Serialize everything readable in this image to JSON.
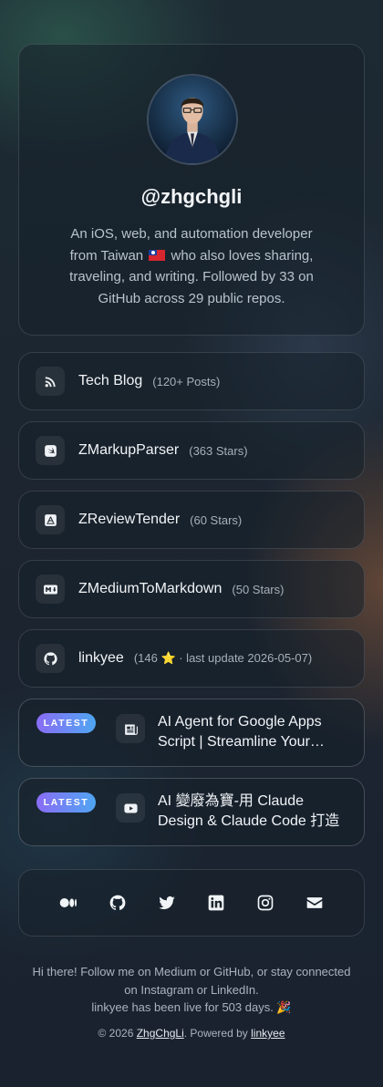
{
  "profile": {
    "handle": "@zhgchgli",
    "bio_before_flag": "An iOS, web, and automation developer from Taiwan",
    "bio_after_flag": "who also loves sharing, traveling, and writing. Followed by 33 on GitHub across 29 public repos."
  },
  "links": [
    {
      "title": "Tech Blog",
      "meta": "(120+ Posts)",
      "icon": "rss-icon"
    },
    {
      "title": "ZMarkupParser",
      "meta": "(363 Stars)",
      "icon": "swift-icon"
    },
    {
      "title": "ZReviewTender",
      "meta": "(60 Stars)",
      "icon": "app-store-icon"
    },
    {
      "title": "ZMediumToMarkdown",
      "meta": "(50 Stars)",
      "icon": "markdown-icon"
    },
    {
      "title": "linkyee",
      "meta": "(146 ⭐ · last update 2026-05-07)",
      "icon": "github-icon"
    }
  ],
  "latest": [
    {
      "badge": "LATEST",
      "title": "AI Agent for Google Apps Script | Streamline Your Workflow",
      "icon": "newspaper-icon"
    },
    {
      "badge": "LATEST",
      "title": "AI 變廢為寶-用 Claude Design & Claude Code 打造",
      "icon": "youtube-icon"
    }
  ],
  "social": [
    "medium-icon",
    "github-icon",
    "twitter-icon",
    "linkedin-icon",
    "instagram-icon",
    "mail-icon"
  ],
  "footer": {
    "line1": "Hi there! Follow me on Medium or GitHub, or stay connected on Instagram or LinkedIn.",
    "line2": "linkyee has been live for 503 days. 🎉",
    "copyright_prefix": "© 2026",
    "copyright_name": "ZhgChgLi",
    "powered_prefix": ". Powered by",
    "powered_name": "linkyee"
  }
}
